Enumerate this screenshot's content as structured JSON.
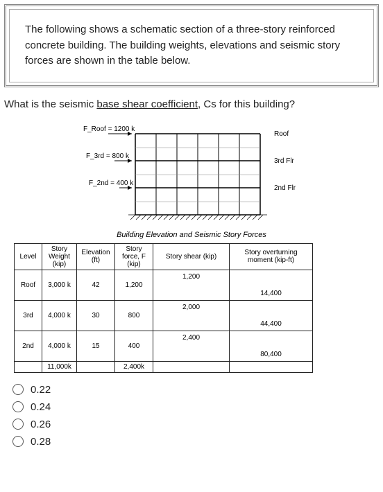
{
  "prompt": "The following shows a schematic section of a three-story reinforced concrete building. The building weights, elevations and seismic story forces are shown in the table below.",
  "question_pre": "What is the seismic ",
  "question_underlined": "base shear coefficient",
  "question_post": ", Cs for this building?",
  "diagram": {
    "forces": {
      "roof_label": "F_Roof = 1200 k",
      "third_label": "F_3rd = 800 k",
      "second_label": "F_2nd = 400 k"
    },
    "levels": {
      "roof": "Roof",
      "third": "3rd Flr",
      "second": "2nd Flr"
    },
    "caption": "Building Elevation and Seismic Story Forces"
  },
  "table": {
    "headers": {
      "level": "Level",
      "weight": "Story Weight (kip)",
      "elevation": "Elevation (ft)",
      "force": "Story force, F (kip)",
      "shear": "Story shear (kip)",
      "moment": "Story overturning moment (kip-ft)"
    },
    "rows": [
      {
        "level": "Roof",
        "weight": "3,000 k",
        "elevation": "42",
        "force": "1,200",
        "shear": "1,200",
        "moment": "14,400"
      },
      {
        "level": "3rd",
        "weight": "4,000 k",
        "elevation": "30",
        "force": "800",
        "shear": "2,000",
        "moment": "44,400"
      },
      {
        "level": "2nd",
        "weight": "4,000 k",
        "elevation": "15",
        "force": "400",
        "shear": "2,400",
        "moment": "80,400"
      }
    ],
    "totals": {
      "weight": "11,000k",
      "force": "2,400k"
    }
  },
  "options": [
    "0.22",
    "0.24",
    "0.26",
    "0.28"
  ]
}
